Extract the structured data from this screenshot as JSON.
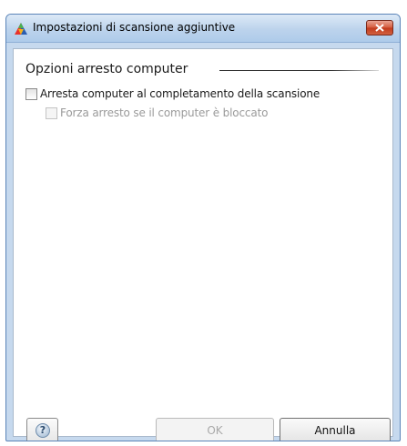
{
  "window": {
    "title": "Impostazioni di scansione aggiuntive",
    "app_icon": "avg-logo-icon",
    "close_icon": "close-icon"
  },
  "section": {
    "header": "Opzioni arresto computer"
  },
  "options": [
    {
      "label": "Arresta computer al completamento della scansione",
      "checked": false,
      "enabled": true
    },
    {
      "label": "Forza arresto se il computer è bloccato",
      "checked": false,
      "enabled": false
    }
  ],
  "buttons": {
    "help_label": "?",
    "ok_label": "OK",
    "cancel_label": "Annulla"
  },
  "colors": {
    "title_bar": "#bcd3ec",
    "close_button": "#d45a3c",
    "disabled_text": "#9a9a9a"
  }
}
